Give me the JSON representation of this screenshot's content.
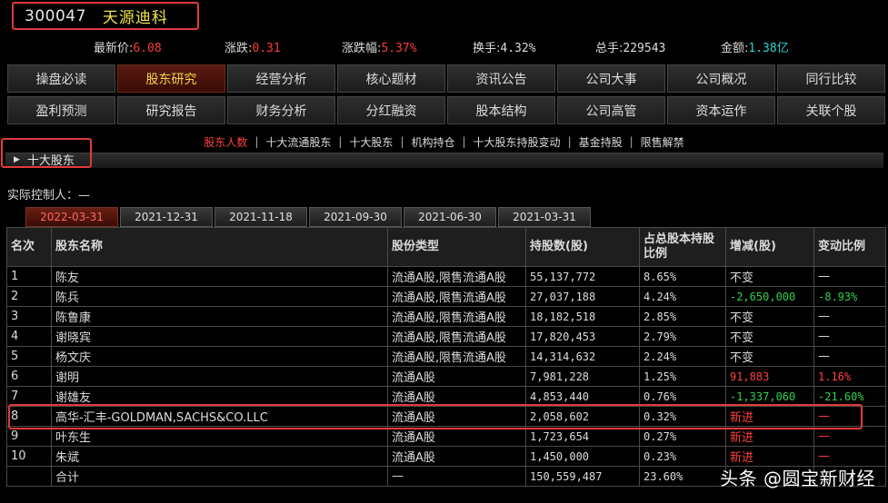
{
  "stock": {
    "code": "300047",
    "name": "天源迪科"
  },
  "quote": [
    {
      "label": "最新价:",
      "value": "6.08",
      "color": "red"
    },
    {
      "label": "涨跌:",
      "value": "0.31",
      "color": "red"
    },
    {
      "label": "涨跌幅:",
      "value": "5.37%",
      "color": "red"
    },
    {
      "label": "换手:",
      "value": "4.32%",
      "color": "white"
    },
    {
      "label": "总手:",
      "value": "229543",
      "color": "white"
    },
    {
      "label": "金额:",
      "value": "1.38亿",
      "color": "cyan"
    }
  ],
  "nav": {
    "row1": [
      "操盘必读",
      "股东研究",
      "经营分析",
      "核心题材",
      "资讯公告",
      "公司大事",
      "公司概况",
      "同行比较"
    ],
    "row2": [
      "盈利预测",
      "研究报告",
      "财务分析",
      "分红融资",
      "股本结构",
      "公司高管",
      "资本运作",
      "关联个股"
    ],
    "active": "股东研究"
  },
  "sub_tabs": [
    "股东人数",
    "十大流通股东",
    "十大股东",
    "机构持仓",
    "十大股东持股变动",
    "基金持股",
    "限售解禁"
  ],
  "sub_tab_active": "股东人数",
  "section_title": "十大股东",
  "controller": "实际控制人：—",
  "date_tabs": [
    "2022-03-31",
    "2021-12-31",
    "2021-11-18",
    "2021-09-30",
    "2021-06-30",
    "2021-03-31"
  ],
  "date_tab_active": "2022-03-31",
  "table": {
    "headers": [
      "名次",
      "股东名称",
      "股份类型",
      "持股数(股)",
      "占总股本持股比例",
      "增减(股)",
      "变动比例"
    ],
    "rows": [
      [
        "1",
        "陈友",
        "流通A股,限售流通A股",
        "55,137,772",
        "8.65%",
        "不变",
        "—"
      ],
      [
        "2",
        "陈兵",
        "流通A股,限售流通A股",
        "27,037,188",
        "4.24%",
        "-2,650,000",
        "-8.93%"
      ],
      [
        "3",
        "陈鲁康",
        "流通A股,限售流通A股",
        "18,182,518",
        "2.85%",
        "不变",
        "—"
      ],
      [
        "4",
        "谢晓宾",
        "流通A股,限售流通A股",
        "17,820,453",
        "2.79%",
        "不变",
        "—"
      ],
      [
        "5",
        "杨文庆",
        "流通A股,限售流通A股",
        "14,314,632",
        "2.24%",
        "不变",
        "—"
      ],
      [
        "6",
        "谢明",
        "流通A股",
        "7,981,228",
        "1.25%",
        "91,883",
        "1.16%"
      ],
      [
        "7",
        "谢雄友",
        "流通A股",
        "4,853,440",
        "0.76%",
        "-1,337,060",
        "-21.60%"
      ],
      [
        "8",
        "高华-汇丰-GOLDMAN,SACHS&CO.LLC",
        "流通A股",
        "2,058,602",
        "0.32%",
        "新进",
        "—"
      ],
      [
        "9",
        "叶东生",
        "流通A股",
        "1,723,654",
        "0.27%",
        "新进",
        "—"
      ],
      [
        "10",
        "朱斌",
        "流通A股",
        "1,450,000",
        "0.23%",
        "新进",
        "—"
      ],
      [
        "",
        "合计",
        "—",
        "150,559,487",
        "23.60%",
        "",
        ""
      ]
    ],
    "change_colors": [
      "",
      "green",
      "",
      "",
      "",
      "red",
      "green",
      "red",
      "red",
      "red",
      ""
    ],
    "ratio_colors": [
      "",
      "green",
      "",
      "",
      "",
      "red",
      "green",
      "red",
      "red",
      "red",
      ""
    ]
  },
  "watermark": "头条 @圆宝新财经"
}
